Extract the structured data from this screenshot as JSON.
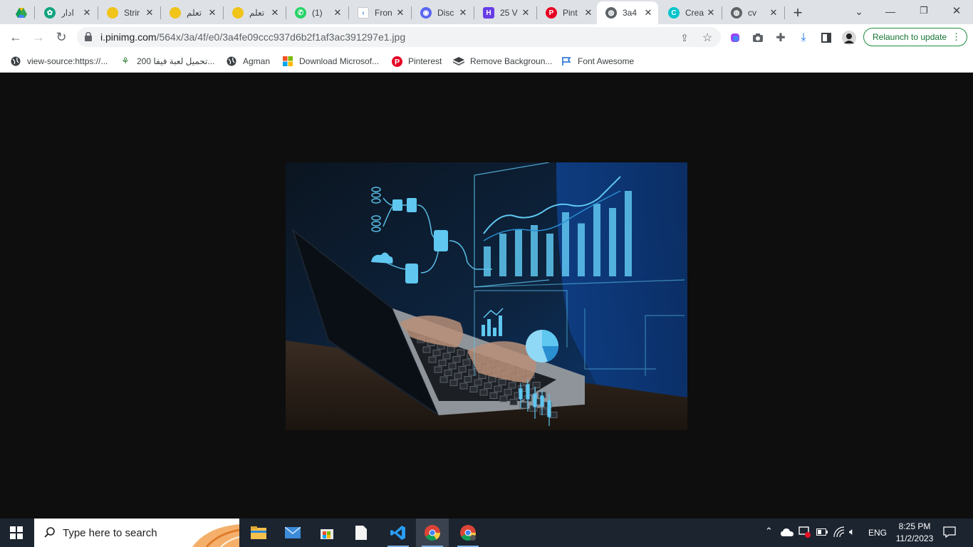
{
  "tabs": [
    {
      "title": "",
      "icon": "google-drive-icon",
      "color": "#fbbc04"
    },
    {
      "title": "ادار",
      "icon": "chatgpt-icon",
      "color": "#10a37f"
    },
    {
      "title": "Strir",
      "icon": "coin-icon",
      "color": "#f0c419"
    },
    {
      "title": "تعلم",
      "icon": "coin-icon",
      "color": "#f0c419"
    },
    {
      "title": "تعلم",
      "icon": "coin-icon",
      "color": "#f0c419"
    },
    {
      "title": "(1)",
      "icon": "whatsapp-icon",
      "color": "#25d366"
    },
    {
      "title": "Fron",
      "icon": "frontend-icon",
      "color": "#4a90d9"
    },
    {
      "title": "Disc",
      "icon": "discord-icon",
      "color": "#5865f2"
    },
    {
      "title": "25 V",
      "icon": "hostinger-icon",
      "color": "#673de6"
    },
    {
      "title": "Pint",
      "icon": "pinterest-icon",
      "color": "#e60023"
    },
    {
      "title": "3a4",
      "icon": "globe-icon",
      "color": "#5f6368",
      "active": true
    },
    {
      "title": "Crea",
      "icon": "canva-icon",
      "color": "#00c4cc"
    },
    {
      "title": "cv",
      "icon": "globe-icon",
      "color": "#5f6368"
    }
  ],
  "omnibox": {
    "host": "i.pinimg.com",
    "path": "/564x/3a/4f/e0/3a4fe09ccc937d6b2f1af3ac391297e1.jpg"
  },
  "relaunch_label": "Relaunch to update",
  "bookmarks": [
    {
      "label": "view-source:https://...",
      "icon": "globe-icon"
    },
    {
      "label": "تحميل لعبة فيفا 200...",
      "icon": "fifa-icon"
    },
    {
      "label": "Agman",
      "icon": "globe-icon"
    },
    {
      "label": "Download Microsof...",
      "icon": "microsoft-icon"
    },
    {
      "label": "Pinterest",
      "icon": "pinterest-icon"
    },
    {
      "label": "Remove Backgroun...",
      "icon": "layers-icon"
    },
    {
      "label": "Font Awesome",
      "icon": "flag-icon"
    }
  ],
  "taskbar": {
    "search_placeholder": "Type here to search",
    "language": "ENG",
    "time": "8:25 PM",
    "date": "11/2/2023"
  },
  "photo": {
    "chart_bars": [
      0.35,
      0.5,
      0.55,
      0.6,
      0.5,
      0.75,
      0.62,
      0.85,
      0.8,
      1.0
    ],
    "accent": "#5fc7f0"
  }
}
